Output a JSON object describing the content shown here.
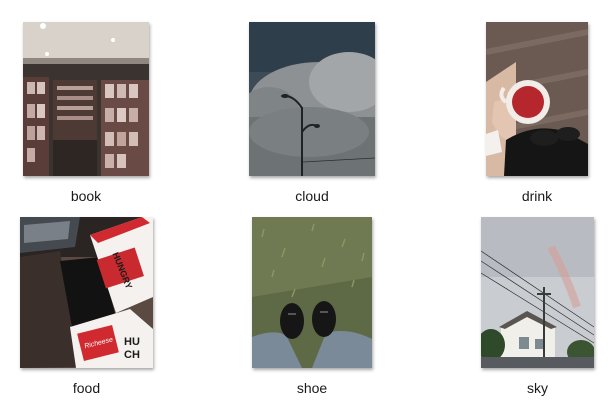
{
  "files": [
    {
      "name": "book",
      "icon": "bookstore-photo-thumbnail-icon"
    },
    {
      "name": "cloud",
      "icon": "cloud-streetlamp-photo-thumbnail-icon"
    },
    {
      "name": "drink",
      "icon": "red-drink-cup-photo-thumbnail-icon"
    },
    {
      "name": "food",
      "icon": "snack-boxes-photo-thumbnail-icon"
    },
    {
      "name": "shoe",
      "icon": "shoes-on-grass-photo-thumbnail-icon"
    },
    {
      "name": "sky",
      "icon": "sky-rainbow-photo-thumbnail-icon"
    }
  ]
}
